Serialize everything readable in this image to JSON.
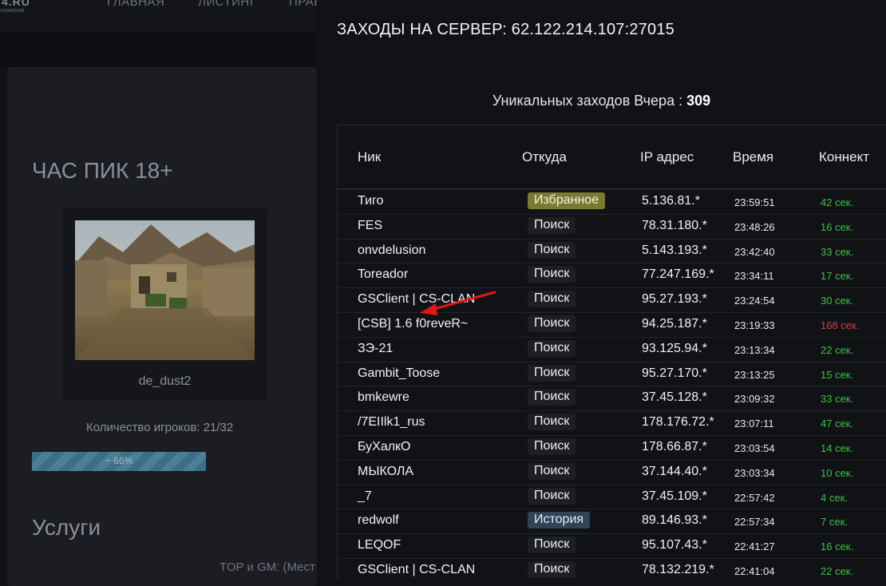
{
  "header": {
    "logo_top": "4.RU",
    "logo_bottom": "серверов",
    "nav": [
      "ГЛАВНАЯ",
      "ЛИСТИНГ",
      "ПРАВ"
    ]
  },
  "server": {
    "name": "ЧАС ПИК 18+",
    "map": "de_dust2",
    "players_label": "Количество игроков:",
    "players_value": "21/32",
    "progress_label": "~ 66%",
    "progress_fraction": 0.66,
    "services_title": "Услуги",
    "top_gm": "TOP и GM:   (Мест"
  },
  "modal": {
    "title": "ЗАХОДЫ НА СЕРВЕР: 62.122.214.107:27015",
    "unique_label": "Уникальных заходов Вчера :",
    "unique_value": "309",
    "columns": {
      "nick": "Ник",
      "source": "Откуда",
      "ip": "IP адрес",
      "time": "Время",
      "connect": "Коннект"
    },
    "rows": [
      {
        "nick": "Тиго",
        "source": "Избранное",
        "source_type": "favorite",
        "ip": "5.136.81.*",
        "time": "23:59:51",
        "connect": "42 сек.",
        "connect_status": "ok"
      },
      {
        "nick": "FES",
        "source": "Поиск",
        "source_type": "search",
        "ip": "78.31.180.*",
        "time": "23:48:26",
        "connect": "16 сек.",
        "connect_status": "ok"
      },
      {
        "nick": "onvdelusion",
        "source": "Поиск",
        "source_type": "search",
        "ip": "5.143.193.*",
        "time": "23:42:40",
        "connect": "33 сек.",
        "connect_status": "ok"
      },
      {
        "nick": "Toreador",
        "source": "Поиск",
        "source_type": "search",
        "ip": "77.247.169.*",
        "time": "23:34:11",
        "connect": "17 сек.",
        "connect_status": "ok"
      },
      {
        "nick": "GSClient | CS-CLAN",
        "source": "Поиск",
        "source_type": "search",
        "ip": "95.27.193.*",
        "time": "23:24:54",
        "connect": "30 сек.",
        "connect_status": "ok"
      },
      {
        "nick": "[CSB] 1.6 f0reveR~",
        "source": "Поиск",
        "source_type": "search",
        "ip": "94.25.187.*",
        "time": "23:19:33",
        "connect": "168 сек.",
        "connect_status": "slow"
      },
      {
        "nick": "ЗЭ-21",
        "source": "Поиск",
        "source_type": "search",
        "ip": "93.125.94.*",
        "time": "23:13:34",
        "connect": "22 сек.",
        "connect_status": "ok"
      },
      {
        "nick": "Gambit_Toose",
        "source": "Поиск",
        "source_type": "search",
        "ip": "95.27.170.*",
        "time": "23:13:25",
        "connect": "15 сек.",
        "connect_status": "ok"
      },
      {
        "nick": "bmkewre",
        "source": "Поиск",
        "source_type": "search",
        "ip": "37.45.128.*",
        "time": "23:09:32",
        "connect": "33 сек.",
        "connect_status": "ok"
      },
      {
        "nick": "/7EIIlk1_rus",
        "source": "Поиск",
        "source_type": "search",
        "ip": "178.176.72.*",
        "time": "23:07:11",
        "connect": "47 сек.",
        "connect_status": "ok"
      },
      {
        "nick": "БуХалкО",
        "source": "Поиск",
        "source_type": "search",
        "ip": "178.66.87.*",
        "time": "23:03:54",
        "connect": "14 сек.",
        "connect_status": "ok"
      },
      {
        "nick": "МЫКОЛА",
        "source": "Поиск",
        "source_type": "search",
        "ip": "37.144.40.*",
        "time": "23:03:34",
        "connect": "10 сек.",
        "connect_status": "ok"
      },
      {
        "nick": "_7",
        "source": "Поиск",
        "source_type": "search",
        "ip": "37.45.109.*",
        "time": "22:57:42",
        "connect": "4 сек.",
        "connect_status": "ok"
      },
      {
        "nick": "redwolf",
        "source": "История",
        "source_type": "history",
        "ip": "89.146.93.*",
        "time": "22:57:34",
        "connect": "7 сек.",
        "connect_status": "ok"
      },
      {
        "nick": "LEQOF",
        "source": "Поиск",
        "source_type": "search",
        "ip": "95.107.43.*",
        "time": "22:41:27",
        "connect": "16 сек.",
        "connect_status": "ok"
      },
      {
        "nick": "GSClient | CS-CLAN",
        "source": "Поиск",
        "source_type": "search",
        "ip": "78.132.219.*",
        "time": "22:41:04",
        "connect": "22 сек.",
        "connect_status": "ok"
      }
    ]
  },
  "colors": {
    "ok": "#39c23f",
    "slow": "#c8454a",
    "favorite": "#7b7a32",
    "history": "#2f4557",
    "arrow": "#e01818"
  }
}
